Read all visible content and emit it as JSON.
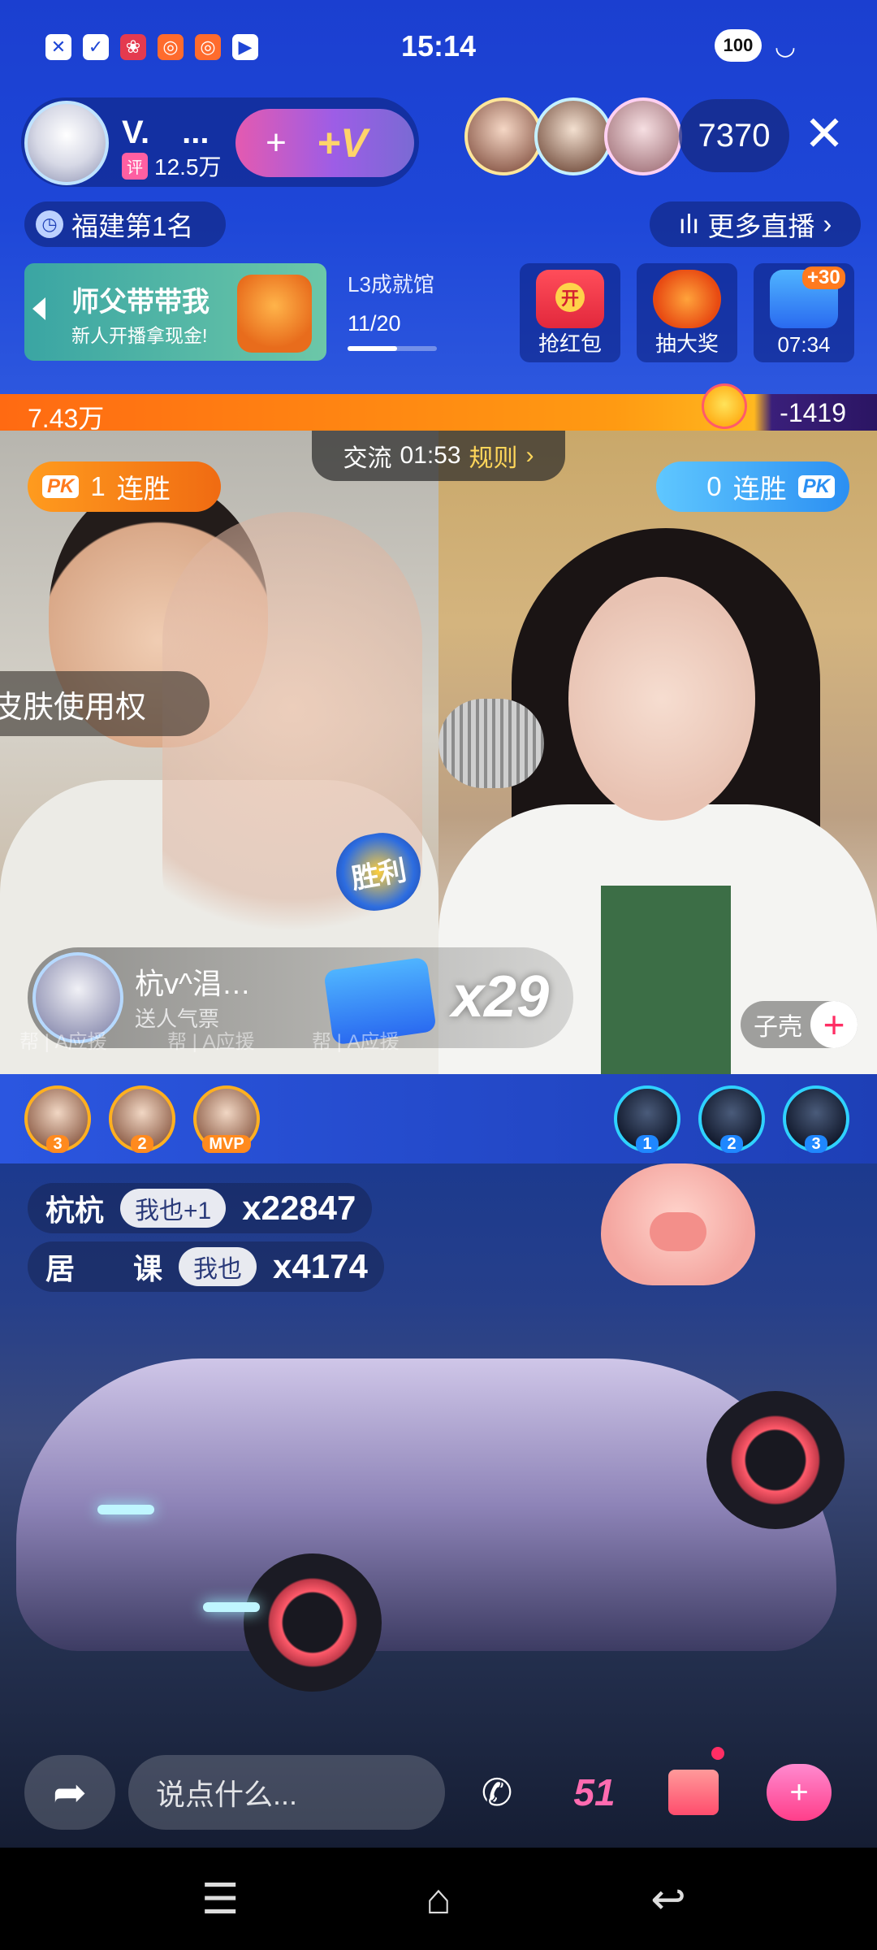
{
  "status_bar": {
    "time": "15:14",
    "battery": "100",
    "left_icons": [
      "close-box-icon",
      "check-box-icon",
      "app-red-icon",
      "app-orange-icon",
      "app-orange2-icon",
      "play-icon"
    ],
    "right_icons": [
      "vibrate-icon",
      "wifi-icon",
      "battery-icon"
    ]
  },
  "host": {
    "name": "V.　...",
    "rating_tag": "评",
    "rating_value": "12.5万",
    "follow_heart": "+",
    "follow_v": "+V"
  },
  "viewers": {
    "count": "7370",
    "close": "✕"
  },
  "rank": {
    "label": "福建第1名"
  },
  "more_live": {
    "label": "更多直播"
  },
  "master_card": {
    "title": "师父带带我",
    "subtitle": "新人开播拿现金!"
  },
  "level": {
    "title": "L3成就馆",
    "progress_text": "11/20",
    "progress_fraction": 0.55
  },
  "activities": {
    "red_packet": {
      "label": "抢红包",
      "badge": "开"
    },
    "lottery": {
      "label": "抽大奖"
    },
    "popularity": {
      "label": "07:34",
      "plus": "+30"
    }
  },
  "pk": {
    "left_score": "7.43万",
    "right_score": "-1419",
    "timer_label": "交流",
    "timer": "01:53",
    "rules": "规则",
    "left_streak_count": "1",
    "left_streak_label": "连胜",
    "right_streak_count": "0",
    "right_streak_label": "连胜",
    "pk_badge": "PK",
    "skin_banner": "皮肤使用权",
    "victory": "胜利"
  },
  "gift": {
    "user": "杭v^淐…",
    "action": "送人气票",
    "count": "x29",
    "help_left": "帮 | A应援",
    "help_mid": "帮 | A应援",
    "help_right": "帮 | A应援"
  },
  "author": {
    "name": "子壳",
    "add": "+"
  },
  "contributors": {
    "left": [
      {
        "rank": "3"
      },
      {
        "rank": "2"
      },
      {
        "rank": "MVP"
      }
    ],
    "right": [
      {
        "rank": "1"
      },
      {
        "rank": "2"
      },
      {
        "rank": "3"
      }
    ]
  },
  "chat": [
    {
      "user": "杭杭",
      "metoo": "我也+1",
      "combo": "x22847"
    },
    {
      "user": "居　　课",
      "metoo": "我也",
      "combo": "x4174"
    }
  ],
  "bottom_bar": {
    "input_placeholder": "说点什么...",
    "fifty_one": "51",
    "share_icon": "share-arrow-icon",
    "link_icon": "video-link-icon",
    "gift_icon": "gift-box-icon",
    "like_icon": "heart-plus-icon"
  },
  "nav": {
    "menu": "☰",
    "home": "⌂",
    "back": "↩"
  }
}
